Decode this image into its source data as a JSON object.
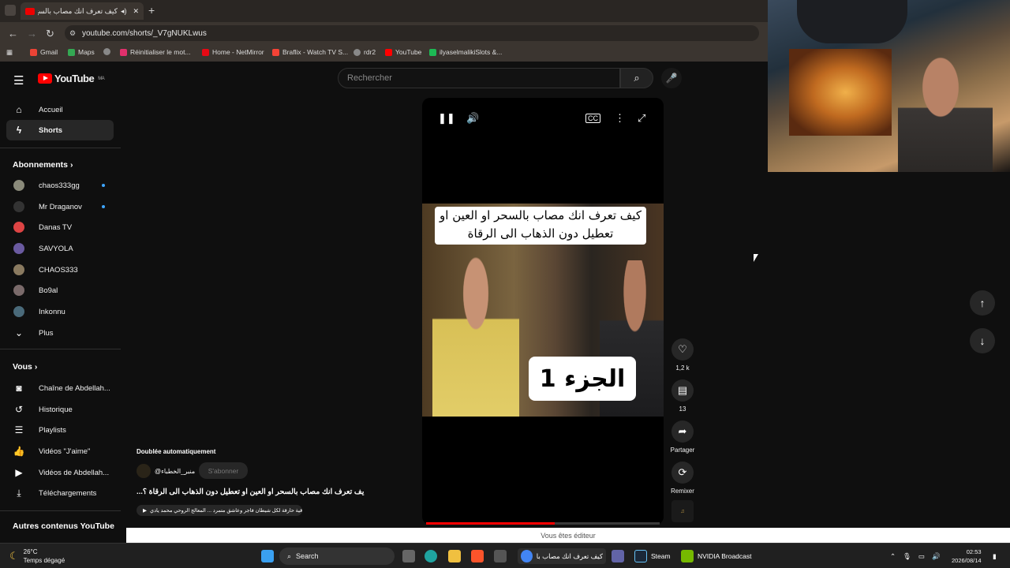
{
  "browser": {
    "tab_title": "كيف تعرف انك مصاب بالسح",
    "new_tab": "+",
    "url": "youtube.com/shorts/_V7gNUKLwus",
    "bookmarks": [
      "Gmail",
      "Maps",
      "Réinitialiser le mot...",
      "Home - NetMirror",
      "Braflix - Watch TV S...",
      "rdr2",
      "YouTube",
      "ilyaselmalikiSlots &..."
    ],
    "bookmark_colors": [
      "#ea4335",
      "#34a853",
      "#e1306c",
      "#e50914",
      "#f44336",
      "#888888",
      "#ff0000",
      "#1db954"
    ]
  },
  "youtube": {
    "logo": "YouTube",
    "region": "MA",
    "search_placeholder": "Rechercher",
    "sidebar": {
      "home": "Accueil",
      "shorts": "Shorts",
      "subscriptions_header": "Abonnements",
      "subscriptions": [
        {
          "name": "chaos333gg",
          "color": "#8a8a7a",
          "new": true
        },
        {
          "name": "Mr Draganov",
          "color": "#333333",
          "new": true
        },
        {
          "name": "Danas TV",
          "color": "#d44",
          "new": false
        },
        {
          "name": "SAVYOLA",
          "color": "#6a5aa0",
          "new": false
        },
        {
          "name": "CHAOS333",
          "color": "#8a7a60",
          "new": false
        },
        {
          "name": "Bo9al",
          "color": "#7a6a6a",
          "new": false
        },
        {
          "name": "Inkonnu",
          "color": "#4a6a7a",
          "new": false
        }
      ],
      "more": "Plus",
      "you_header": "Vous",
      "you_items": [
        "Chaîne de Abdellah...",
        "Historique",
        "Playlists",
        "Vidéos \"J'aime\"",
        "Vidéos de Abdellah...",
        "Téléchargements"
      ],
      "other_header": "Autres contenus YouTube"
    },
    "short": {
      "caption_title": "كيف تعرف انك مصاب بالسحر او العين او تعطيل دون الذهاب الى الرقاة",
      "part_label": "الجزء 1",
      "dubbed": "Doublée automatiquement",
      "channel": "@منبر_الخطباء",
      "subscribe": "S'abonner",
      "title": "...يف تعرف انك مصاب بالسحر او العين او تعطيل دون الذهاب الى الرقاة ؟",
      "sound": "رقية حارقة لكل شيطان فاجر وعاشق متمرد ... المعالج الروحي محمد يادي",
      "progress": 0.55,
      "likes": "1,2 k",
      "comments": "13",
      "share": "Partager",
      "remix": "Remixer"
    },
    "editor_notice": "Vous êtes éditeur"
  },
  "taskbar": {
    "weather_temp": "26°C",
    "weather_desc": "Temps dégagé",
    "search": "Search",
    "app_chrome": "كيف تعرف انك مصاب بالا",
    "app_steam": "Steam",
    "app_nvidia": "NVIDIA Broadcast",
    "time": "02:53",
    "date": "2026/08/14"
  }
}
